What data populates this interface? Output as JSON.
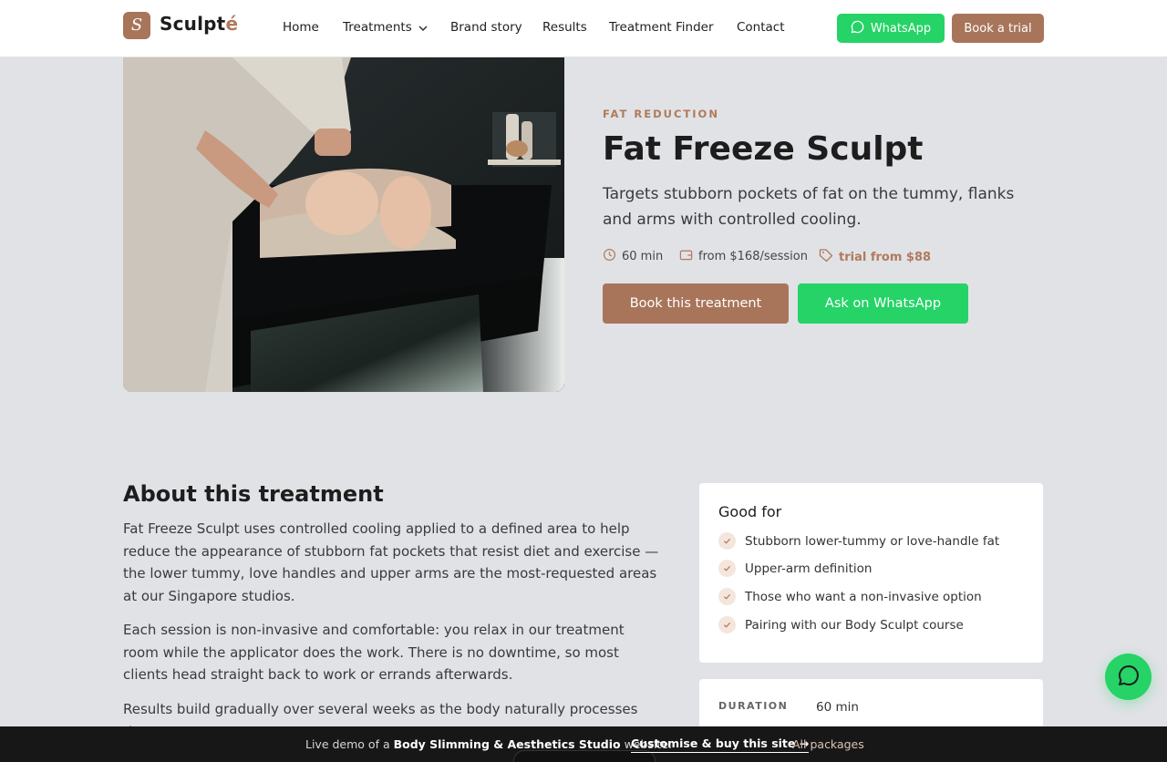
{
  "header": {
    "logo_letter": "S",
    "brand_main": "Sculpt",
    "brand_accent": "é",
    "nav": [
      "Home",
      "Treatments",
      "Brand story",
      "Results",
      "Treatment Finder",
      "Contact"
    ],
    "whatsapp_label": "WhatsApp",
    "book_trial_label": "Book a trial"
  },
  "hero": {
    "eyebrow": "FAT REDUCTION",
    "title": "Fat Freeze Sculpt",
    "subtitle": "Targets stubborn pockets of fat on the tummy, flanks and arms with controlled cooling.",
    "duration": "60 min",
    "price": "from $168/session",
    "trial": "trial from $88",
    "book_label": "Book this treatment",
    "ask_label": "Ask on WhatsApp"
  },
  "about": {
    "heading": "About this treatment",
    "paragraphs": [
      "Fat Freeze Sculpt uses controlled cooling applied to a defined area to help reduce the appearance of stubborn fat pockets that resist diet and exercise — the lower tummy, love handles and upper arms are the most-requested areas at our Singapore studios.",
      "Each session is non-invasive and comfortable: you relax in our treatment room while the applicator does the work. There is no downtime, so most clients head straight back to work or errands afterwards.",
      "Results build gradually over several weeks as the body naturally processes the"
    ]
  },
  "good_for": {
    "heading": "Good for",
    "items": [
      "Stubborn lower-tummy or love-handle fat",
      "Upper-arm definition",
      "Those who want a non-invasive option",
      "Pairing with our Body Sculpt course"
    ]
  },
  "details": {
    "duration_label": "DURATION",
    "duration_value": "60 min"
  },
  "bottom_bar": {
    "prefix": "Live demo of a ",
    "studio": "Body Slimming & Aesthetics Studio",
    "suffix": " website.",
    "cta": "Customise & buy this site →",
    "all": "All packages"
  },
  "colors": {
    "brand": "#a8755a",
    "whatsapp": "#25d366",
    "page_bg": "#e1e2e6",
    "dark_bar": "#171717"
  },
  "icons": [
    "logo-mark-icon",
    "chevron-down-icon",
    "whatsapp-icon",
    "clock-icon",
    "wallet-icon",
    "tag-icon",
    "check-icon",
    "chat-bubble-icon"
  ]
}
